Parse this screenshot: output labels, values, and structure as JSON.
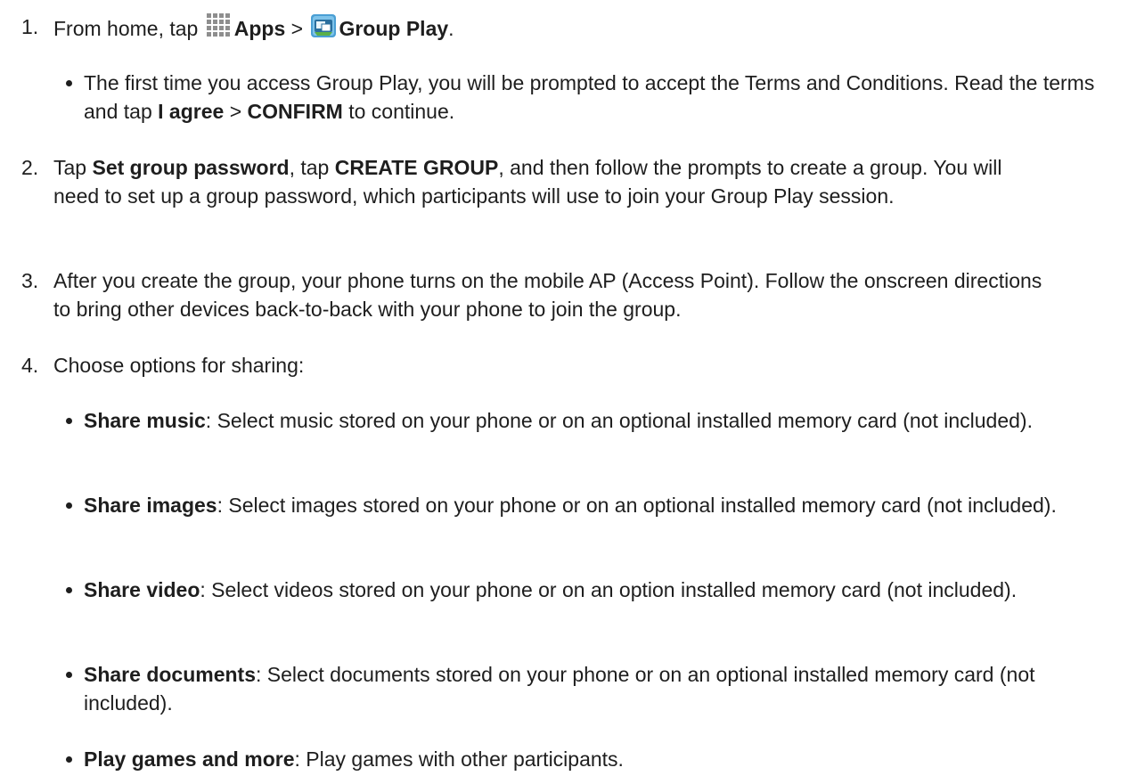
{
  "steps": [
    {
      "num": "1.",
      "parts": {
        "pre": "From home, tap",
        "apps_icon": "apps-grid-icon",
        "apps_label": "Apps",
        "sep": ">",
        "group_play_icon": "group-play-app-icon",
        "group_play_label": "Group Play",
        "end": "."
      },
      "bullets": [
        {
          "pre": "The first time you access Group Play, you will be prompted to accept the Terms and Conditions. Read the terms and tap",
          "b1": "I agree",
          "sep": ">",
          "b2": "CONFIRM",
          "post": "to continue."
        }
      ]
    },
    {
      "num": "2.",
      "parts": {
        "pre": "Tap",
        "b1": "Set group password",
        "mid": ", tap",
        "b2": "CREATE GROUP",
        "post": ", and then follow the prompts to create a group. You will need to set up a group password, which participants will use to join your Group Play session."
      }
    },
    {
      "num": "3.",
      "text": "After you create the group, your phone turns on the mobile AP (Access Point). Follow the onscreen directions to bring other devices back-to-back with your phone to join the group."
    },
    {
      "num": "4.",
      "text": "Choose options for sharing:",
      "bullets": [
        {
          "term": "Share music",
          "desc": ": Select music stored on your phone or on an optional installed memory card (not included)."
        },
        {
          "term": "Share images",
          "desc": ": Select images stored on your phone or on an optional installed memory card (not included)."
        },
        {
          "term": "Share video",
          "desc": ": Select videos stored on your phone or on an option installed memory card (not included)."
        },
        {
          "term": "Share documents",
          "desc": ": Select documents stored on your phone or on an optional installed memory card (not included)."
        },
        {
          "term": "Play games and more",
          "desc": ": Play games with other participants."
        }
      ]
    }
  ]
}
